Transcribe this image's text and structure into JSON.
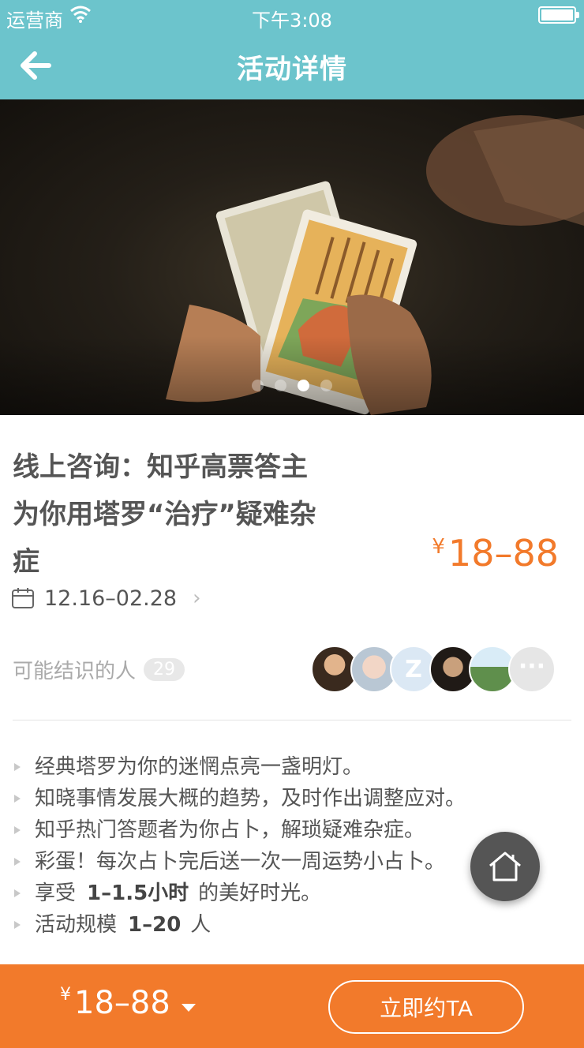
{
  "status_bar": {
    "carrier": "运营商",
    "time": "下午3:08"
  },
  "nav": {
    "title": "活动详情"
  },
  "banner": {
    "slide_count": 4,
    "active_slide": 3
  },
  "activity": {
    "title_lines": [
      "线上咨询：知乎高票答主",
      "为你用塔罗“治疗”疑难杂",
      "症"
    ],
    "currency": "¥",
    "price": "18–88",
    "date_range": "12.16–02.28"
  },
  "people": {
    "label": "可能结识的人",
    "count": "29",
    "more": "···"
  },
  "description": [
    {
      "text": "经典塔罗为你的迷惘点亮一盏明灯。"
    },
    {
      "text": "知晓事情发展大概的趋势，及时作出调整应对。"
    },
    {
      "text": "知乎热门答题者为你占卜，解琐疑难杂症。"
    },
    {
      "text": "彩蛋！每次占卜完后送一次一周运势小占卜。"
    },
    {
      "prefix": "享受",
      "bold": "1–1.5小时",
      "suffix": "的美好时光。"
    },
    {
      "prefix": "活动规模",
      "bold": "1–20",
      "suffix": "人"
    }
  ],
  "bottom_bar": {
    "currency": "¥",
    "price": "18–88",
    "cta_label": "立即约TA"
  },
  "colors": {
    "teal": "#6cc4cc",
    "orange": "#f27a2b"
  }
}
